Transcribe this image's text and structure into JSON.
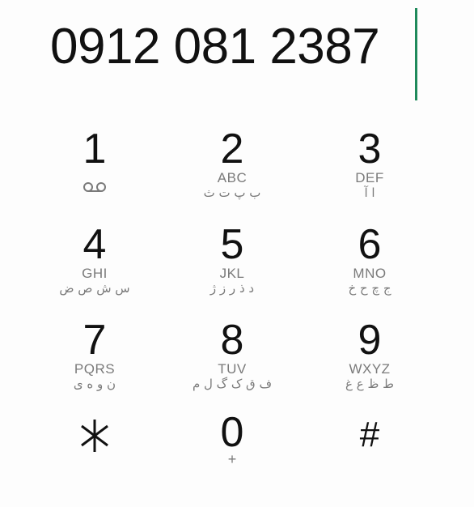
{
  "display": {
    "number": "0912 081 2387"
  },
  "keypad": {
    "keys": [
      {
        "digit": "1",
        "letters": "",
        "persian": "",
        "icon": "voicemail-icon"
      },
      {
        "digit": "2",
        "letters": "ABC",
        "persian": "ب پ ت ث"
      },
      {
        "digit": "3",
        "letters": "DEF",
        "persian": "ا آ"
      },
      {
        "digit": "4",
        "letters": "GHI",
        "persian": "س ش ص ض"
      },
      {
        "digit": "5",
        "letters": "JKL",
        "persian": "د ذ ر ز ژ"
      },
      {
        "digit": "6",
        "letters": "MNO",
        "persian": "ج چ ح خ"
      },
      {
        "digit": "7",
        "letters": "PQRS",
        "persian": "ن و ه ی"
      },
      {
        "digit": "8",
        "letters": "TUV",
        "persian": "ف ق ک گ ل م"
      },
      {
        "digit": "9",
        "letters": "WXYZ",
        "persian": "ط ظ ع غ"
      },
      {
        "digit": "*",
        "letters": "",
        "persian": ""
      },
      {
        "digit": "0",
        "letters": "+",
        "persian": ""
      },
      {
        "digit": "#",
        "letters": "",
        "persian": ""
      }
    ]
  },
  "colors": {
    "caret": "#1f8a5b",
    "digit": "#111111",
    "sublabel": "#7a7a7a",
    "background": "#fdfdfd"
  }
}
